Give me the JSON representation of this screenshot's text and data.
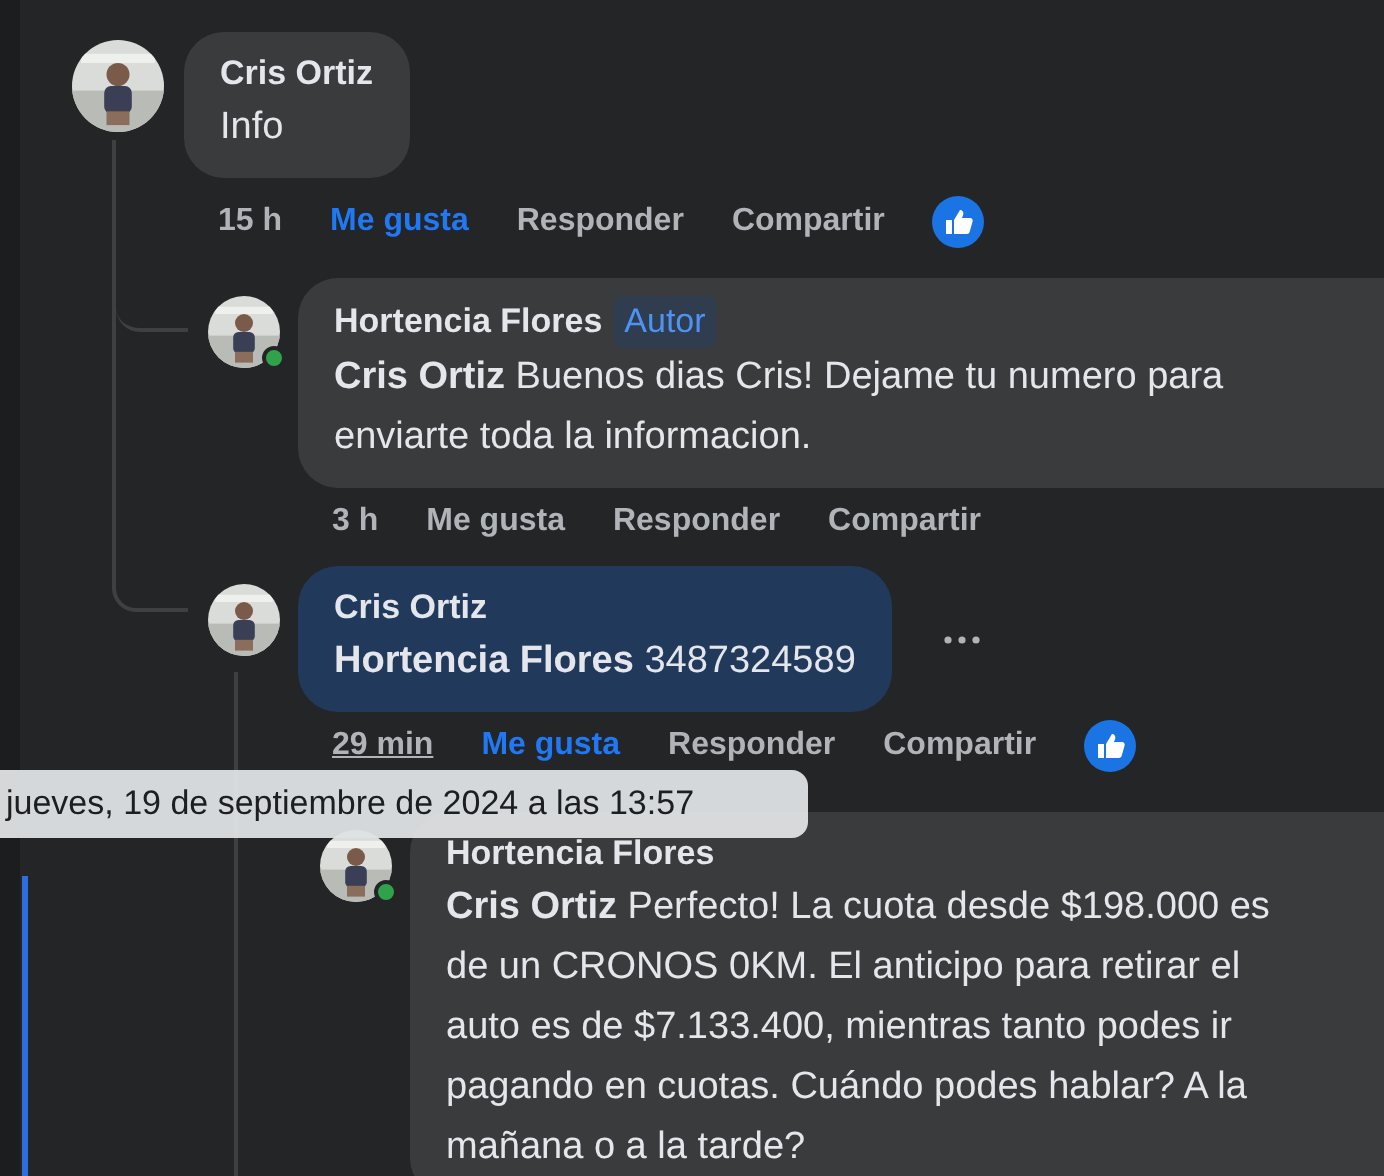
{
  "comments": [
    {
      "author": "Cris Ortiz",
      "text": "Info",
      "avatar": {
        "kind": "picture",
        "online": false
      },
      "highlighted": false,
      "hovered": false,
      "time": "15 h",
      "like": {
        "label": "Me gusta",
        "active": true
      },
      "reply": "Responder",
      "share": "Compartir",
      "reactions": true,
      "replies": [
        {
          "author": "Hortencia Flores",
          "badge": "Autor",
          "text": "**Cris Ortiz** Buenos dias Cris! Dejame tu numero para enviarte toda la informacion.",
          "avatar": {
            "kind": "picture",
            "online": true
          },
          "highlighted": false,
          "hovered": false,
          "time": "3 h",
          "like": {
            "label": "Me gusta",
            "active": false
          },
          "reply": "Responder",
          "share": "Compartir",
          "reactions": false
        },
        {
          "author": "Cris Ortiz",
          "text": "**Hortencia Flores** 3487324589",
          "avatar": {
            "kind": "picture",
            "online": false
          },
          "highlighted": true,
          "hovered": true,
          "time": "29 min",
          "like": {
            "label": "Me gusta",
            "active": true
          },
          "reply": "Responder",
          "share": "Compartir",
          "reactions": true,
          "replies": [
            {
              "author": "Hortencia Flores",
              "text": "**Cris Ortiz** Perfecto! La cuota desde $198.000 es de un CRONOS 0KM. El anticipo para retirar el auto es de $7.133.400, mientras tanto podes ir pagando en cuotas. Cuándo podes hablar? A la mañana o a la tarde?",
              "avatar": {
                "kind": "picture",
                "online": true
              },
              "highlighted": false,
              "hovered": false
            }
          ]
        }
      ]
    }
  ],
  "tooltip": {
    "text": "jueves, 19 de septiembre de 2024 a las 13:57"
  }
}
